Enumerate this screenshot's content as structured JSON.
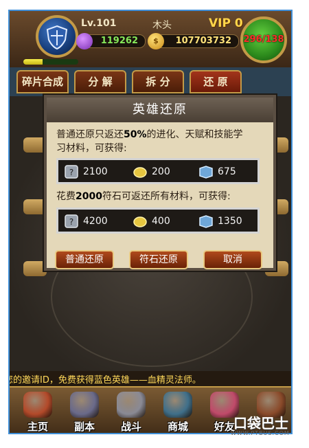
{
  "hud": {
    "level": "Lv.101",
    "player_name": "木头",
    "vip": "VIP 0",
    "gems": "119262",
    "gold": "107703732",
    "stamina": "296/138",
    "xp_fraction": 0.35
  },
  "tabs": [
    {
      "label": "碎片合成",
      "active": false
    },
    {
      "label": "分 解",
      "active": false
    },
    {
      "label": "拆 分",
      "active": false
    },
    {
      "label": "还 原",
      "active": true
    }
  ],
  "dialog": {
    "title": "英雄还原",
    "normal_desc_pre": "普通还原只返还",
    "normal_desc_pct": "50%",
    "normal_desc_post": "的进化、天赋和技能学",
    "normal_desc_line2": "习材料，可获得:",
    "normal_rewards": [
      {
        "icon": "puzzle-piece-icon",
        "value": "2100"
      },
      {
        "icon": "gold-nugget-icon",
        "value": "200"
      },
      {
        "icon": "skill-book-icon",
        "value": "675"
      }
    ],
    "rune_desc_pre": "花费",
    "rune_desc_num": "2000",
    "rune_desc_post": "符石可返还所有材料，可获得:",
    "rune_rewards": [
      {
        "icon": "puzzle-piece-icon",
        "value": "4200"
      },
      {
        "icon": "gold-nugget-icon",
        "value": "400"
      },
      {
        "icon": "skill-book-icon",
        "value": "1350"
      }
    ],
    "buttons": {
      "normal": "普通还原",
      "rune": "符石还原",
      "cancel": "取消"
    }
  },
  "marquee": "您的邀请ID，免费获得蓝色英雄——血精灵法师。",
  "nav": [
    {
      "label": "主页",
      "icon": "home-icon",
      "color": "#b34a2a"
    },
    {
      "label": "副本",
      "icon": "dungeon-icon",
      "color": "#6a6a8a"
    },
    {
      "label": "战斗",
      "icon": "battle-swords-icon",
      "color": "#8a8a95"
    },
    {
      "label": "商城",
      "icon": "shop-icon",
      "color": "#3f6f8a"
    },
    {
      "label": "好友",
      "icon": "friends-icon",
      "color": "#c04a6a"
    },
    {
      "label": "",
      "icon": "more-icon",
      "color": "#8a4a2a"
    }
  ],
  "watermark": {
    "brand": "口袋巴士",
    "url": "WWW.PTBUS.COM"
  },
  "colors": {
    "tab_active": "#a3341b",
    "accent_gold": "#c39a47",
    "dialog_bg": "#e4d8b9",
    "frame_border": "#3f8fd8"
  }
}
